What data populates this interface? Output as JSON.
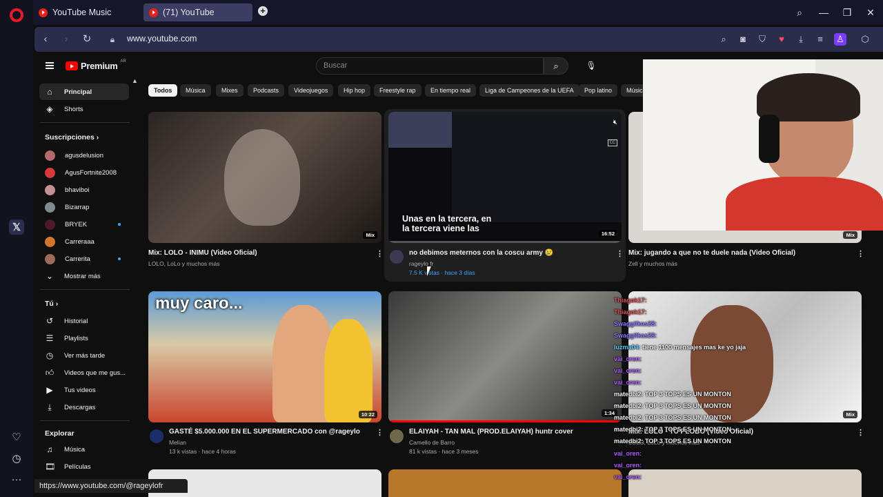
{
  "browser": {
    "tabs": [
      {
        "title": "YouTube Music"
      },
      {
        "title": "(71) YouTube"
      }
    ],
    "url": "www.youtube.com",
    "status_url": "https://www.youtube.com/@rageylofr"
  },
  "youtube": {
    "logo": "Premium",
    "region": "AR",
    "search_placeholder": "Buscar"
  },
  "sidebar": {
    "main": [
      {
        "label": "Principal",
        "icon": "home-icon"
      },
      {
        "label": "Shorts",
        "icon": "shorts-icon"
      }
    ],
    "subscriptions_title": "Suscripciones",
    "subscriptions": [
      {
        "label": "agusdelusion",
        "color": "#b46a6a"
      },
      {
        "label": "AgusFortnite2008",
        "color": "#d63a3a"
      },
      {
        "label": "bhaviboi",
        "color": "#c49292"
      },
      {
        "label": "Bizarrap",
        "color": "#7f8a8f"
      },
      {
        "label": "BRYEK",
        "color": "#4d1a2a"
      },
      {
        "label": "Carreraaa",
        "color": "#d2762e"
      },
      {
        "label": "Carrerita",
        "color": "#9c6a5a"
      }
    ],
    "show_more": "Mostrar más",
    "you_title": "Tú",
    "you_items": [
      {
        "label": "Historial",
        "icon": "history-icon"
      },
      {
        "label": "Playlists",
        "icon": "playlists-icon"
      },
      {
        "label": "Ver más tarde",
        "icon": "watch-later-icon"
      },
      {
        "label": "Videos que me gus...",
        "icon": "like-icon"
      },
      {
        "label": "Tus videos",
        "icon": "your-videos-icon"
      },
      {
        "label": "Descargas",
        "icon": "downloads-icon"
      }
    ],
    "explore_title": "Explorar",
    "explore_items": [
      {
        "label": "Música",
        "icon": "music-icon"
      },
      {
        "label": "Películas",
        "icon": "movies-icon"
      }
    ]
  },
  "chips": [
    "Todos",
    "Música",
    "Mixes",
    "Podcasts",
    "Videojuegos",
    "Hip hop",
    "Freestyle rap",
    "En tiempo real",
    "Liga de Campeones de la UEFA",
    "Pop latino",
    "Músic"
  ],
  "videos": [
    {
      "title": "Mix: LOLO - INIMU (Video Oficial)",
      "channel": "LOLO, LoLo y muchos más",
      "meta": "",
      "badge": "Mix"
    },
    {
      "title": "no debimos meternos con la coscu army 😢",
      "channel": "rageylo fr",
      "meta": "7.5 K vistas · hace 3 días",
      "badge": "16:52",
      "caption": "Unas en la tercera, en la tercera viene las"
    },
    {
      "title": "Mix: jugando a que no te duele nada (Video Oficial)",
      "channel": "Zell y muchos más",
      "meta": "",
      "badge": "Mix"
    },
    {
      "title": "GASTÉ $5.000.000 EN EL SUPERMERCADO con @rageylo",
      "channel": "Melian",
      "meta": "13 k vistas · hace 4 horas",
      "badge": "10:22",
      "overlay": "muy caro..."
    },
    {
      "title": "ELAIYAH - TAN MAL (PROD.ELAIYAH)  huntr cover",
      "channel": "Camello de Barro",
      "meta": "81 k vistas · hace 3 meses",
      "badge": "1:34"
    },
    {
      "title": "Mix: LOLO - TU PLOBO (Video Oficial)",
      "channel": "LOLO, LoLo y muchos más",
      "meta": "",
      "badge": "Mix"
    }
  ],
  "chat": [
    {
      "user": "Thiagok17:",
      "msg": "",
      "color": "#e35353"
    },
    {
      "user": "Thiagok17:",
      "msg": "",
      "color": "#e35353"
    },
    {
      "user": "Swaggilkas28:",
      "msg": "",
      "color": "#8a7cff"
    },
    {
      "user": "Swaggilkas28:",
      "msg": "",
      "color": "#8a7cff"
    },
    {
      "user": "luzma04:",
      "msg": "tiene 1100 mensajes mas ke yo jaja",
      "color": "#5ad1ff"
    },
    {
      "user": "vai_oren:",
      "msg": "",
      "color": "#b15cff"
    },
    {
      "user": "vai_oren:",
      "msg": "",
      "color": "#b15cff"
    },
    {
      "user": "vai_oren:",
      "msg": "",
      "color": "#b15cff"
    },
    {
      "user": "matedbi2:",
      "msg": "TOP 3 TOPS ES UN MONTON",
      "color": "#ffffff"
    },
    {
      "user": "matedbi2:",
      "msg": "TOP 3 TOPS ES UN MONTON",
      "color": "#ffffff"
    },
    {
      "user": "matedbi2:",
      "msg": "TOP 3 TOPS ES UN MONTON",
      "color": "#ffffff"
    },
    {
      "user": "matedbi2:",
      "msg": "TOP 3 TOPS ES UN MONTON",
      "color": "#ffffff"
    },
    {
      "user": "matedbi2:",
      "msg": "TOP 3 TOPS ES UN MONTON",
      "color": "#ffffff"
    },
    {
      "user": "vai_oren:",
      "msg": "",
      "color": "#b15cff"
    },
    {
      "user": "vai_oren:",
      "msg": "",
      "color": "#b15cff"
    },
    {
      "user": "vai_oren:",
      "msg": "",
      "color": "#b15cff"
    }
  ]
}
